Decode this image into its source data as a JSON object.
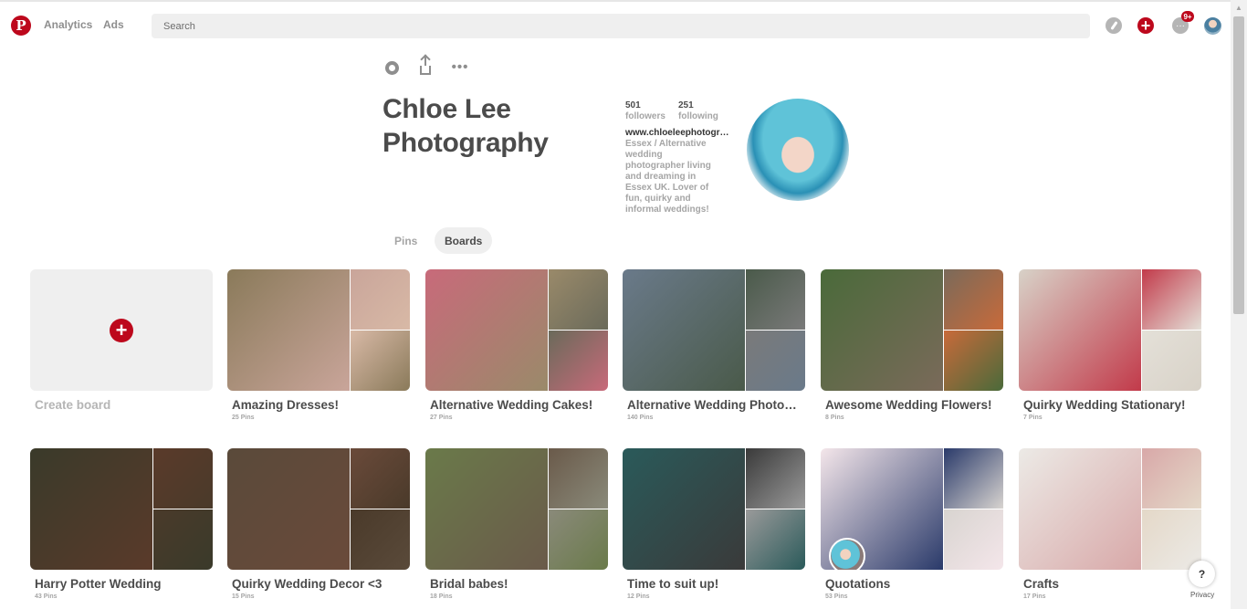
{
  "nav": {
    "analytics": "Analytics",
    "ads": "Ads",
    "search_placeholder": "Search",
    "notification_badge": "9+"
  },
  "profile": {
    "name": "Chloe Lee Photography",
    "followers_count": "501",
    "followers_label": "followers",
    "following_count": "251",
    "following_label": "following",
    "website": "www.chloeleephotography.co.uk",
    "bio": "Essex / Alternative wedding photographer living and dreaming in Essex UK. Lover of fun, quirky and informal weddings!"
  },
  "tabs": {
    "pins": "Pins",
    "boards": "Boards"
  },
  "create_board": "Create board",
  "boards": [
    {
      "title": "Amazing Dresses!",
      "pins": "25 Pins",
      "colors": [
        "#8a7a5a",
        "#c9a59a",
        "#d8b9a6"
      ]
    },
    {
      "title": "Alternative Wedding Cakes!",
      "pins": "27 Pins",
      "colors": [
        "#c86a7a",
        "#9a8a6a",
        "#6a6a5a"
      ]
    },
    {
      "title": "Alternative Wedding Photography",
      "pins": "140 Pins",
      "colors": [
        "#6a7a8a",
        "#4a5a4a",
        "#7a7a7a"
      ]
    },
    {
      "title": "Awesome Wedding Flowers!",
      "pins": "8 Pins",
      "colors": [
        "#4a6a3a",
        "#7a6a5a",
        "#c86a3a"
      ]
    },
    {
      "title": "Quirky Wedding Stationary!",
      "pins": "7 Pins",
      "colors": [
        "#d8d2c8",
        "#c23a4a",
        "#e4e0d8"
      ]
    },
    {
      "title": "Harry Potter Wedding",
      "pins": "43 Pins",
      "colors": [
        "#3a3a2a",
        "#5a3a2a",
        "#4a3a2a"
      ]
    },
    {
      "title": "Quirky Wedding Decor <3",
      "pins": "15 Pins",
      "colors": [
        "#5a4a3a",
        "#6a4a3a",
        "#4a3a2a"
      ]
    },
    {
      "title": "Bridal babes!",
      "pins": "18 Pins",
      "colors": [
        "#6a7a4a",
        "#6a5a4a",
        "#8a8a7a"
      ]
    },
    {
      "title": "Time to suit up!",
      "pins": "12 Pins",
      "colors": [
        "#2a5a5a",
        "#3a3a3a",
        "#9a9a9a"
      ]
    },
    {
      "title": "Quotations",
      "pins": "53 Pins",
      "colors": [
        "#f4e6ea",
        "#2a3a6a",
        "#d8d4d0"
      ]
    },
    {
      "title": "Crafts",
      "pins": "17 Pins",
      "colors": [
        "#eceae6",
        "#d8a8a8",
        "#e4d8c8"
      ]
    }
  ],
  "help": "?",
  "privacy": "Privacy"
}
